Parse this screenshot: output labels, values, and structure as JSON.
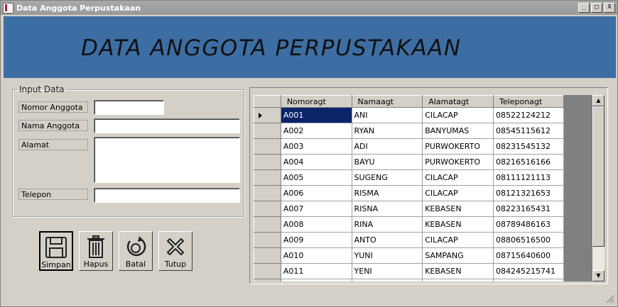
{
  "window": {
    "title": "Data Anggota Perpustakaan",
    "controls": [
      "_",
      "□",
      "X"
    ]
  },
  "banner": {
    "title": "DATA ANGGOTA PERPUSTAKAAN",
    "bg_color": "#3c6ea3"
  },
  "form": {
    "legend": "Input Data",
    "labels": {
      "nomor": "Nomor Anggota",
      "nama": "Nama Anggota",
      "alamat": "Alamat",
      "telepon": "Telepon"
    },
    "values": {
      "nomor": "",
      "nama": "",
      "alamat": "",
      "telepon": ""
    }
  },
  "buttons": {
    "simpan": "Simpan",
    "hapus": "Hapus",
    "batal": "Batal",
    "tutup": "Tutup"
  },
  "grid": {
    "columns": [
      "Nomoragt",
      "Namaagt",
      "Alamatagt",
      "Teleponagt"
    ],
    "selected_row": 0,
    "rows": [
      [
        "A001",
        "ANI",
        "CILACAP",
        "08522124212"
      ],
      [
        "A002",
        "RYAN",
        "BANYUMAS",
        "08545115612"
      ],
      [
        "A003",
        "ADI",
        "PURWOKERTO",
        "08231545132"
      ],
      [
        "A004",
        "BAYU",
        "PURWOKERTO",
        "08216516166"
      ],
      [
        "A005",
        "SUGENG",
        "CILACAP",
        "08111121113"
      ],
      [
        "A006",
        "RISMA",
        "CILACAP",
        "08121321653"
      ],
      [
        "A007",
        "RISNA",
        "KEBASEN",
        "08223165431"
      ],
      [
        "A008",
        "RINA",
        "KEBASEN",
        "08789486163"
      ],
      [
        "A009",
        "ANTO",
        "CILACAP",
        "08806516500"
      ],
      [
        "A010",
        "YUNI",
        "SAMPANG",
        "08715640600"
      ],
      [
        "A011",
        "YENI",
        "KEBASEN",
        "084245215741"
      ],
      [
        "",
        "",
        "",
        ""
      ]
    ]
  }
}
